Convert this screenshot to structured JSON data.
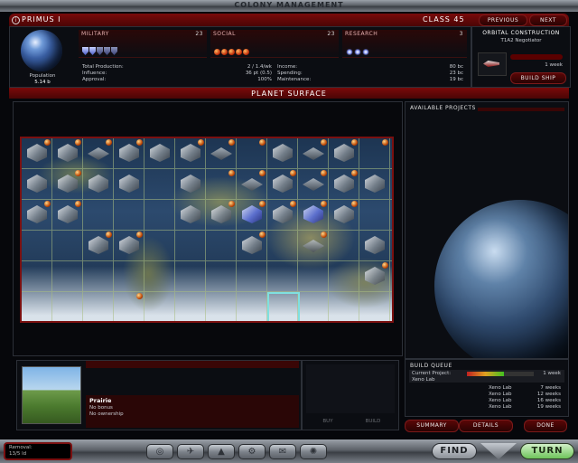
{
  "window": {
    "title": "Colony Management"
  },
  "planet": {
    "name": "Primus I",
    "class_label": "Class 45",
    "population_label": "Population",
    "population_value": "5.14 b"
  },
  "nav": {
    "previous": "Previous",
    "next": "Next"
  },
  "stats": {
    "military": {
      "label": "Military",
      "value": "23"
    },
    "social": {
      "label": "Social",
      "value": "23"
    },
    "research": {
      "label": "Research",
      "value": "3"
    }
  },
  "economy": {
    "left": [
      {
        "label": "Total Production:",
        "value": "2 / 1.4/wk"
      },
      {
        "label": "Influence:",
        "value": "36 pt (0.5)"
      },
      {
        "label": "Approval:",
        "value": "100%"
      }
    ],
    "right": [
      {
        "label": "Income:",
        "value": "80 bc"
      },
      {
        "label": "Spending:",
        "value": "23 bc"
      },
      {
        "label": "Maintenance:",
        "value": "19 bc"
      }
    ]
  },
  "orbital": {
    "header": "Orbital Construction",
    "ship": "T1A2 Negotiator",
    "time": "1 week",
    "button": "Build Ship"
  },
  "surface": {
    "header": "Planet Surface",
    "grid": [
      [
        "bp",
        "bp",
        "rp",
        "bp",
        "b",
        "bp",
        "rp",
        "p",
        "b",
        "rp",
        "bp",
        "p",
        "bp"
      ],
      [
        "x",
        "bp",
        "x",
        "b",
        "e",
        "b",
        "p",
        "rp",
        "bp",
        "rp",
        "bp",
        "b",
        "bp"
      ],
      [
        "bp",
        "bp",
        "e",
        "e",
        "e",
        "b",
        "bp",
        "cp",
        "bp",
        "cp",
        "bp",
        "e",
        "e"
      ],
      [
        "e",
        "e",
        "bp",
        "bp",
        "e",
        "e",
        "e",
        "bp",
        "e",
        "rp",
        "e",
        "b",
        "cp"
      ],
      [
        "e",
        "e",
        "e",
        "e",
        "e",
        "e",
        "e",
        "e",
        "e",
        "e",
        "e",
        "bp",
        "bp"
      ],
      [
        "e",
        "e",
        "e",
        "p",
        "e",
        "e",
        "e",
        "e",
        "e",
        "e",
        "e",
        "e",
        "e"
      ]
    ]
  },
  "projects": {
    "header": "Available Projects"
  },
  "tile": {
    "name": "Prairie",
    "line1": "No bonus",
    "line2": "No ownership"
  },
  "actions": {
    "buy": "Buy",
    "build": "Build"
  },
  "build_queue": {
    "header": "Build Queue",
    "items": [
      {
        "name": "Current Project:\nXeno Lab",
        "time": "1 week"
      },
      {
        "name": "Xeno Lab",
        "time": "7 weeks"
      },
      {
        "name": "Xeno Lab",
        "time": "12 weeks"
      },
      {
        "name": "Xeno Lab",
        "time": "16 weeks"
      },
      {
        "name": "Xeno Lab",
        "time": "19 weeks"
      }
    ],
    "progress": 0.55
  },
  "footer_tabs": {
    "summary": "Summary",
    "details": "Details",
    "done": "Done"
  },
  "status": {
    "line1": "Removal:",
    "line2": "13/5 ld"
  },
  "bottom": {
    "find": "Find",
    "turn": "Turn"
  },
  "bottom_icons": [
    "planet-icon",
    "ship-icon",
    "warning-icon",
    "gear-icon",
    "mail-icon",
    "globe-icon"
  ]
}
